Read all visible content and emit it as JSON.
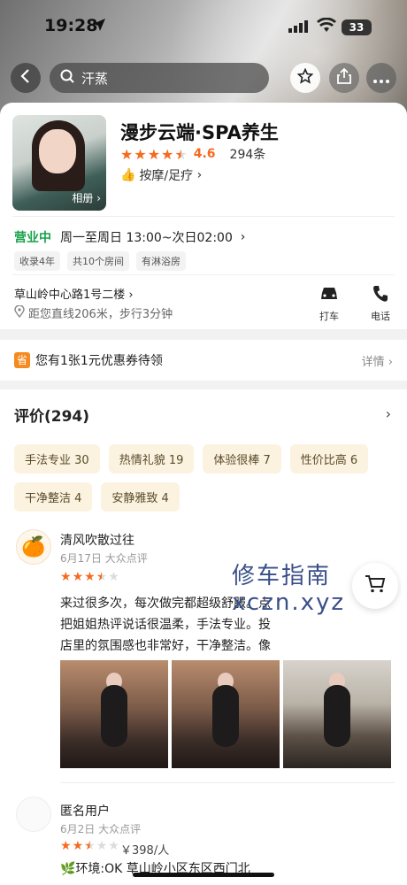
{
  "status_bar": {
    "time": "19:28",
    "battery": "33"
  },
  "nav": {
    "search_text": "汗蒸"
  },
  "shop": {
    "name": "漫步云端·SPA养生",
    "photo_label": "相册",
    "rating": 4.6,
    "rating_text": "4.6",
    "review_count": "294条",
    "category": "按摩/足疗",
    "open_status": "营业中",
    "hours": "周一至周日 13:00~次日02:00",
    "tags": [
      "收录4年",
      "共10个房间",
      "有淋浴房"
    ],
    "address": "草山岭中心路1号二楼",
    "distance": "距您直线206米，步行3分钟",
    "actions": {
      "taxi": "打车",
      "phone": "电话"
    }
  },
  "coupon": {
    "icon_text": "省",
    "text": "您有1张1元优惠券待领",
    "detail": "详情"
  },
  "reviews": {
    "title": "评价(294)",
    "chips": [
      "手法专业 30",
      "热情礼貌 19",
      "体验很棒 7",
      "性价比高 6",
      "干净整洁 4",
      "安静雅致 4"
    ],
    "items": [
      {
        "user": "清风吹散过往",
        "date": "6月17日 大众点评",
        "stars": 3.5,
        "text": "来过很多次，每次做完都超级舒服。点把姐姐热评说话很温柔，手法专业。投店里的氛围感也非常好，干净整洁。像",
        "photo_count": 3
      },
      {
        "user": "匿名用户",
        "date": "6月2日 大众点评",
        "stars": 2.5,
        "price": "￥398/人",
        "text": "环境:OK 草山岭小区东区西门北"
      }
    ]
  },
  "watermark": {
    "line1": "修车指南",
    "line2": "xczn.xyz"
  },
  "icons": [
    "location-arrow-icon",
    "signal-icon",
    "wifi-icon",
    "back-icon",
    "search-icon",
    "star-icon",
    "share-icon",
    "more-icon",
    "thumb-icon",
    "chevron-right-icon",
    "car-icon",
    "phone-icon",
    "location-pin-icon",
    "coupon-icon",
    "orange-avatar-icon",
    "leaf-icon",
    "cart-icon"
  ],
  "colors": {
    "accent": "#f56a1f",
    "open_green": "#19a14a",
    "chip_bg": "#fbf3e0",
    "coupon_orange": "#f58a1f"
  }
}
